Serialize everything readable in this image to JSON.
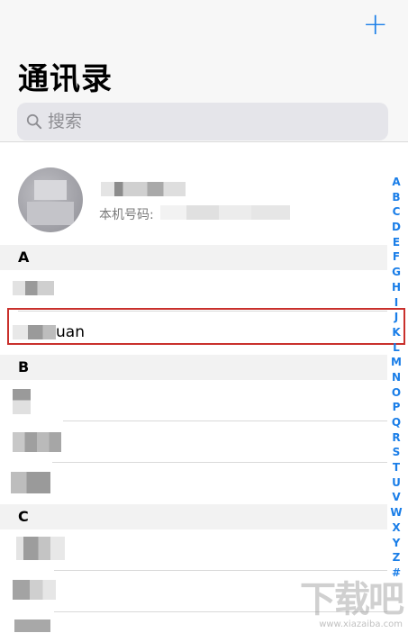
{
  "header": {
    "add_label": "+",
    "title": "通讯录"
  },
  "search": {
    "placeholder": "搜索"
  },
  "my_card": {
    "number_label": "本机号码:"
  },
  "sections": [
    {
      "letter": "A",
      "rows": [
        "",
        "uan"
      ]
    },
    {
      "letter": "B",
      "rows": [
        "",
        "",
        ""
      ]
    },
    {
      "letter": "C",
      "rows": [
        "",
        ""
      ]
    }
  ],
  "index_letters": [
    "A",
    "B",
    "C",
    "D",
    "E",
    "F",
    "G",
    "H",
    "I",
    "J",
    "K",
    "L",
    "M",
    "N",
    "O",
    "P",
    "Q",
    "R",
    "S",
    "T",
    "U",
    "V",
    "W",
    "X",
    "Y",
    "Z",
    "#"
  ],
  "watermark": {
    "logo": "下载吧",
    "url": "www.xiazaiba.com"
  },
  "colors": {
    "accent": "#1a7ee8",
    "highlight_border": "#c9302c"
  }
}
